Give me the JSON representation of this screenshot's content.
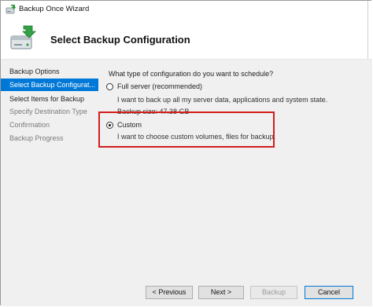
{
  "window": {
    "title": "Backup Once Wizard",
    "icon": "backup-wizard-icon"
  },
  "header": {
    "title": "Select Backup Configuration",
    "icon": "backup-drive-icon"
  },
  "sidebar": {
    "items": [
      {
        "label": "Backup Options",
        "state": "normal"
      },
      {
        "label": "Select Backup Configurat...",
        "state": "active"
      },
      {
        "label": "Select Items for Backup",
        "state": "normal"
      },
      {
        "label": "Specify Destination Type",
        "state": "disabled"
      },
      {
        "label": "Confirmation",
        "state": "disabled"
      },
      {
        "label": "Backup Progress",
        "state": "disabled"
      }
    ]
  },
  "main": {
    "question": "What type of configuration do you want to schedule?",
    "options": [
      {
        "label": "Full server (recommended)",
        "description": "I want to back up all my server data, applications and system state.",
        "extra": "Backup size: 47.38 GB",
        "selected": false
      },
      {
        "label": "Custom",
        "description": "I want to choose custom volumes, files for backup.",
        "selected": true
      }
    ]
  },
  "footer": {
    "previous_label": "< Previous",
    "next_label": "Next >",
    "backup_label": "Backup",
    "backup_enabled": false,
    "cancel_label": "Cancel"
  },
  "colors": {
    "selection": "#0078d7",
    "highlight_border": "#d21d1d",
    "panel_background": "#f0f0f0"
  }
}
